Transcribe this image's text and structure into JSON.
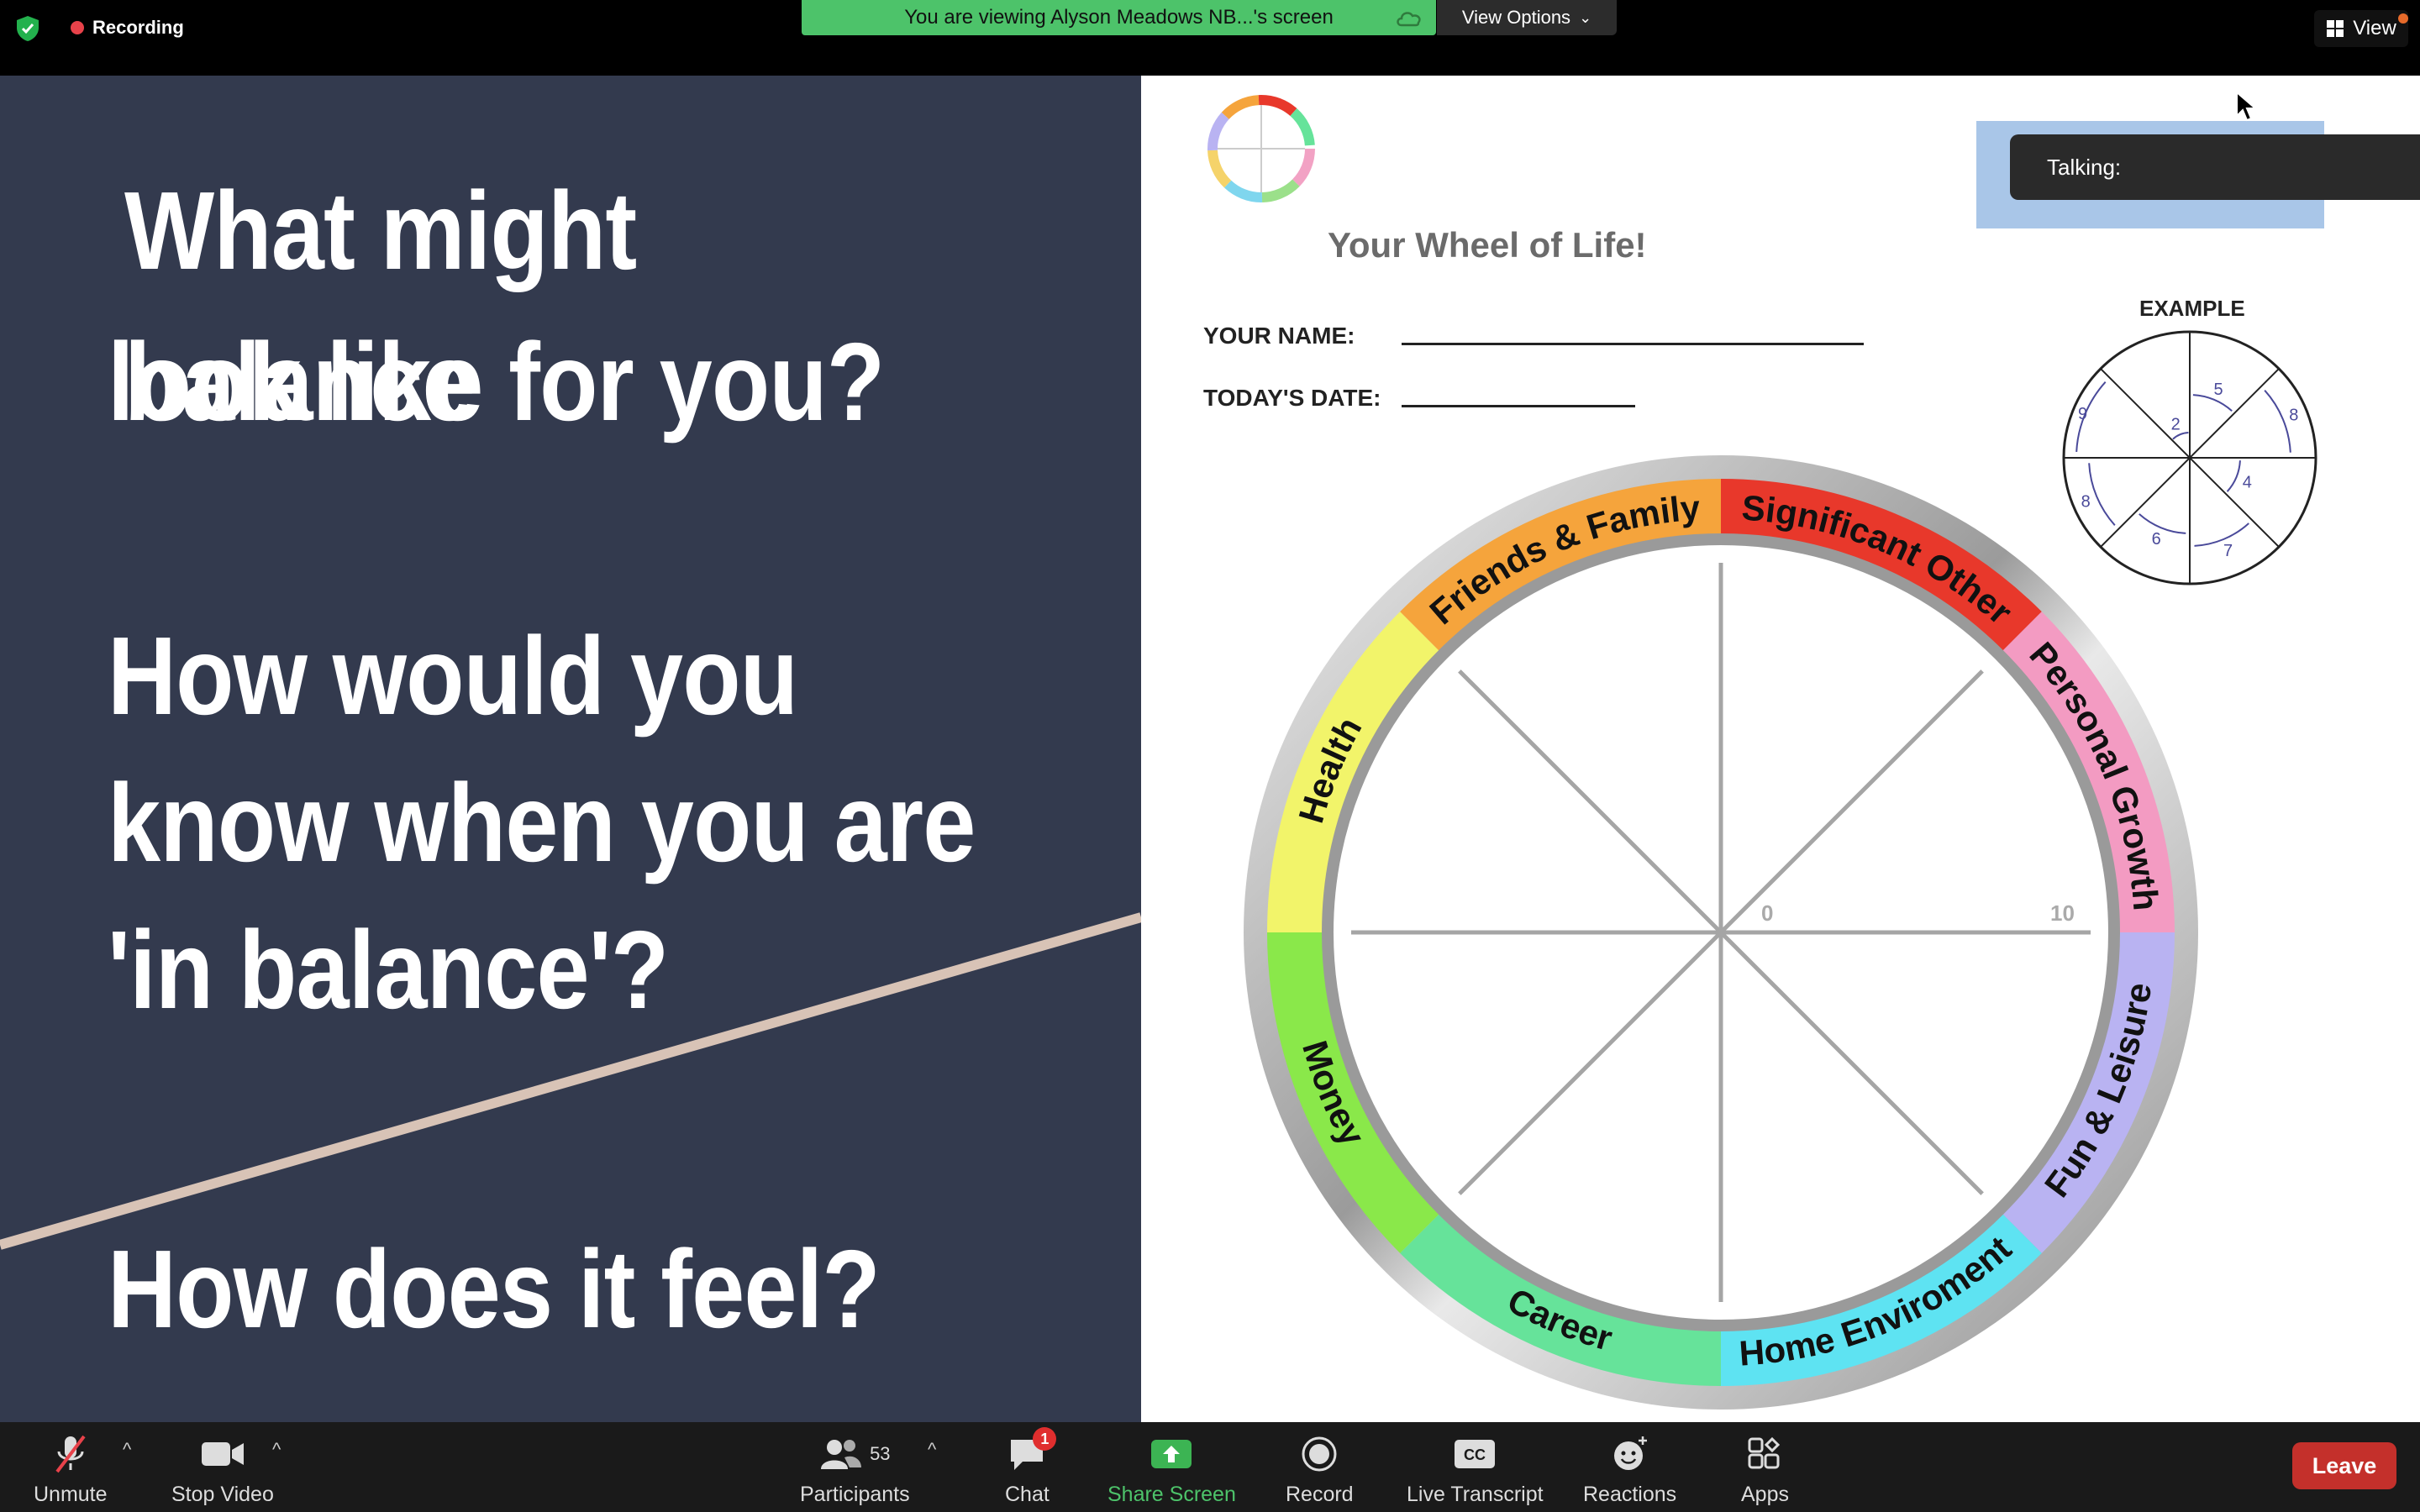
{
  "topbar": {
    "recording_label": "Recording",
    "viewing_text": "You are viewing Alyson Meadows NB...'s screen",
    "view_options_label": "View Options",
    "view_label": "View"
  },
  "slide": {
    "line1": "What might balance",
    "line2": "look like for you?",
    "line3": "How would you",
    "line4": "know when you are",
    "line5": "'in balance'?",
    "line6": "How does it feel?"
  },
  "worksheet": {
    "title": "Your Wheel of Life!",
    "name_label": "YOUR NAME:",
    "date_label": "TODAY'S DATE:",
    "example_label": "EXAMPLE",
    "scale_min": "0",
    "scale_max": "10",
    "segments": [
      {
        "label": "Significant Other",
        "color": "#e8382b"
      },
      {
        "label": "Personal Growth",
        "color": "#f39bc2"
      },
      {
        "label": "Fun & Leisure",
        "color": "#b9b3f2"
      },
      {
        "label": "Home Enviroment",
        "color": "#5ee3f2"
      },
      {
        "label": "Career",
        "color": "#66e39a"
      },
      {
        "label": "Money",
        "color": "#8ae84a"
      },
      {
        "label": "Health",
        "color": "#f2f46a"
      },
      {
        "label": "Friends & Family",
        "color": "#f5a43c"
      }
    ],
    "example_numbers": [
      "5",
      "8",
      "4",
      "7",
      "6",
      "8",
      "9",
      "2"
    ]
  },
  "talking": {
    "label": "Talking:"
  },
  "toolbar": {
    "unmute_label": "Unmute",
    "stop_video_label": "Stop Video",
    "participants_label": "Participants",
    "participants_count": "53",
    "chat_label": "Chat",
    "chat_badge": "1",
    "share_screen_label": "Share Screen",
    "record_label": "Record",
    "live_transcript_label": "Live Transcript",
    "reactions_label": "Reactions",
    "apps_label": "Apps",
    "leave_label": "Leave"
  },
  "colors": {
    "slide_bg": "#333a4e",
    "share_green": "#4dc36a",
    "leave_red": "#c4302b"
  }
}
